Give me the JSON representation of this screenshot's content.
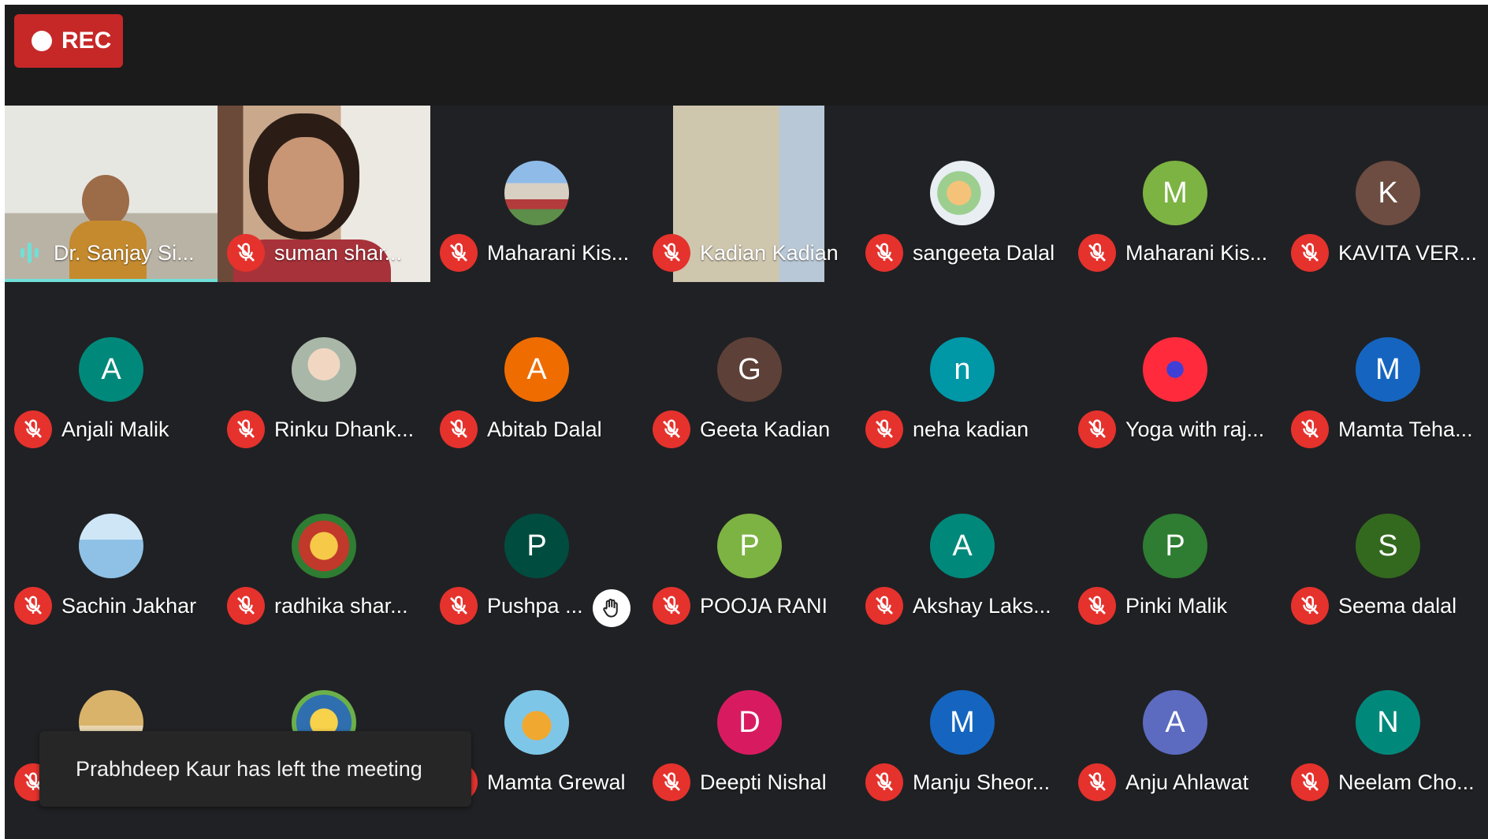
{
  "recording": {
    "label": "REC"
  },
  "participants": [
    {
      "name": "Dr. Sanjay Si...",
      "speaking": true,
      "video": "man"
    },
    {
      "name": "suman shar...",
      "video": "woman"
    },
    {
      "name": "Maharani Kis...",
      "photo": "building"
    },
    {
      "name": "Kadian Kadian",
      "video": "wall"
    },
    {
      "name": "sangeeta Dalal",
      "photo": "map"
    },
    {
      "name": "Maharani Kis...",
      "initial": "M",
      "color": "#7cb342"
    },
    {
      "name": "KAVITA VER...",
      "initial": "K",
      "color": "#6d4c41"
    },
    {
      "name": "Anjali Malik",
      "initial": "A",
      "color": "#00897b"
    },
    {
      "name": "Rinku Dhank...",
      "photo": "baby"
    },
    {
      "name": "Abitab Dalal",
      "initial": "A",
      "color": "#ef6c00"
    },
    {
      "name": "Geeta Kadian",
      "initial": "G",
      "color": "#5d4037"
    },
    {
      "name": "neha kadian",
      "initial": "n",
      "color": "#0097a7"
    },
    {
      "name": "Yoga with raj...",
      "photo": "yoga"
    },
    {
      "name": "Mamta Teha...",
      "initial": "M",
      "color": "#1565c0"
    },
    {
      "name": "Sachin Jakhar",
      "photo": "statue"
    },
    {
      "name": "radhika shar...",
      "photo": "deity"
    },
    {
      "name": "Pushpa ...",
      "initial": "P",
      "color": "#004d40",
      "hand_raised": true
    },
    {
      "name": "POOJA RANI",
      "initial": "P",
      "color": "#7cb342"
    },
    {
      "name": "Akshay Laks...",
      "initial": "A",
      "color": "#00897b"
    },
    {
      "name": "Pinki Malik",
      "initial": "P",
      "color": "#2e7d32"
    },
    {
      "name": "Seema dalal",
      "initial": "S",
      "color": "#33691e"
    },
    {
      "name": "",
      "photo": "lady"
    },
    {
      "name": "",
      "photo": "deity2"
    },
    {
      "name": "Mamta Grewal",
      "photo": "buddha"
    },
    {
      "name": "Deepti Nishal",
      "initial": "D",
      "color": "#d81b60"
    },
    {
      "name": "Manju Sheor...",
      "initial": "M",
      "color": "#1565c0"
    },
    {
      "name": "Anju Ahlawat",
      "initial": "A",
      "color": "#5c6bc0"
    },
    {
      "name": "Neelam Cho...",
      "initial": "N",
      "color": "#00897b"
    }
  ],
  "toast": {
    "message": "Prabhdeep Kaur has left the meeting"
  },
  "icons": {
    "muted": "mic-off-icon",
    "raised_hand": "raised-hand-icon",
    "speaking": "audio-level-icon"
  }
}
